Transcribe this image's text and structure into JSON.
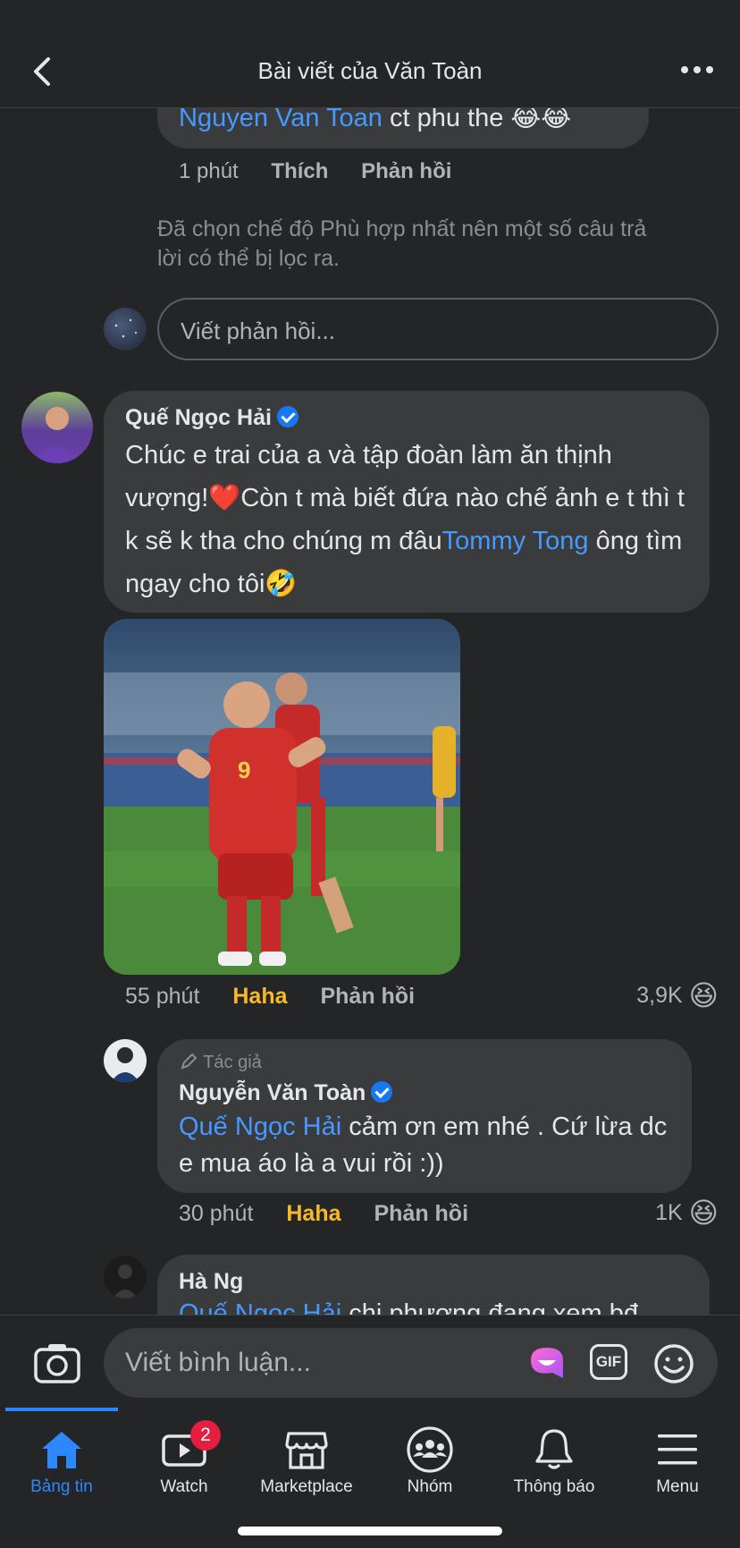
{
  "header": {
    "title": "Bài viết của Văn Toàn"
  },
  "prev_reply": {
    "mention": "Nguyen Van Toan",
    "text": "ct phu the 😂😂",
    "time": "1 phút",
    "like": "Thích",
    "reply": "Phản hồi"
  },
  "filter_notice": "Đã chọn chế độ Phù hợp nhất nên một số câu trả lời có thể bị lọc ra.",
  "reply_input_placeholder": "Viết phản hồi...",
  "comment1": {
    "author": "Quế Ngọc Hải",
    "text_before": "Chúc e trai của a và tập đoàn làm ăn thịnh vượng!❤️Còn t mà biết đứa nào chế ảnh e t thì t k sẽ k tha cho chúng m đâu",
    "mention": "Tommy Tong",
    "text_after": " ông tìm ngay cho tôi🤣",
    "time": "55 phút",
    "reaction_label": "Haha",
    "reply": "Phản hồi",
    "reaction_count": "3,9K",
    "reaction_emoji": "😆"
  },
  "comment2": {
    "badge": "Tác giả",
    "author": "Nguyễn Văn Toàn",
    "mention": "Quế Ngọc Hải",
    "text": " cảm ơn em nhé . Cứ lừa dc e mua áo là a vui rồi :))",
    "time": "30 phút",
    "reaction_label": "Haha",
    "reply": "Phản hồi",
    "reaction_count": "1K",
    "reaction_emoji": "😆"
  },
  "comment3": {
    "author": "Hà Ng",
    "mention": "Quế Ngọc Hải",
    "text": " chi phương đang xem bđ"
  },
  "composer": {
    "placeholder": "Viết bình luận...",
    "gif_label": "GIF"
  },
  "tabs": [
    {
      "label": "Bảng tin",
      "icon": "home-icon",
      "active": true
    },
    {
      "label": "Watch",
      "icon": "video-icon",
      "badge": "2"
    },
    {
      "label": "Marketplace",
      "icon": "store-icon"
    },
    {
      "label": "Nhóm",
      "icon": "groups-icon"
    },
    {
      "label": "Thông báo",
      "icon": "bell-icon"
    },
    {
      "label": "Menu",
      "icon": "menu-icon"
    }
  ],
  "colors": {
    "background": "#242526",
    "bubble": "#3a3b3c",
    "link": "#4599ff",
    "haha": "#f7b928",
    "active_tab": "#2d88ff"
  }
}
